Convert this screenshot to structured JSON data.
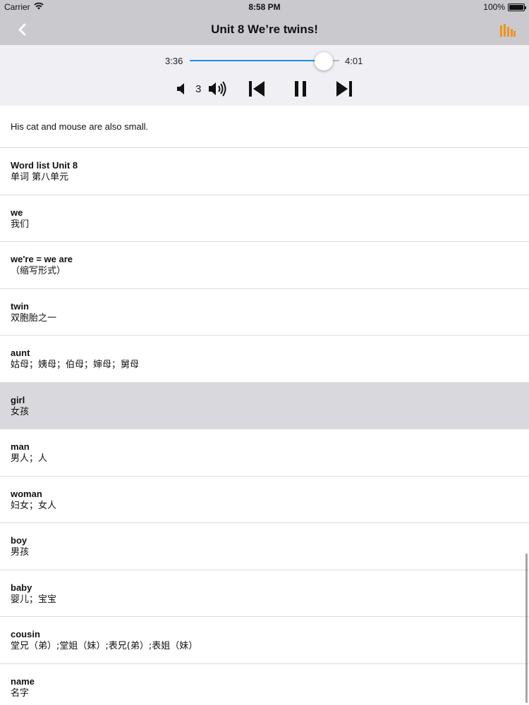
{
  "status_bar": {
    "carrier": "Carrier",
    "time": "8:58 PM",
    "battery": "100%",
    "battery_level": 1.0
  },
  "nav": {
    "title": "Unit 8 We’re twins!",
    "back_icon": "chevron-left-icon",
    "right_icon": "bar-chart-icon",
    "accent_color": "#f0931f"
  },
  "player": {
    "current_time": "3:36",
    "total_time": "4:01",
    "progress": 0.896,
    "volume": "3",
    "accent_color": "#1a8fe3"
  },
  "list": {
    "sentence": "His cat and mouse are also small.",
    "items": [
      {
        "word": "Word list Unit 8",
        "meaning": "单词 第八单元"
      },
      {
        "word": "we",
        "meaning": "我们"
      },
      {
        "word": "we're = we are",
        "meaning": "（缩写形式）"
      },
      {
        "word": "twin",
        "meaning": "双胞胎之一"
      },
      {
        "word": "aunt",
        "meaning": "姑母；姨母；伯母；婶母；舅母"
      },
      {
        "word": "girl",
        "meaning": "女孩"
      },
      {
        "word": "man",
        "meaning": "男人；人"
      },
      {
        "word": "woman",
        "meaning": "妇女；女人"
      },
      {
        "word": "boy",
        "meaning": "男孩"
      },
      {
        "word": "baby",
        "meaning": "婴儿；宝宝"
      },
      {
        "word": "cousin",
        "meaning": "堂兄（弟）;堂姐（妹）;表兄(弟）;表姐（妹）"
      },
      {
        "word": "name",
        "meaning": "名字"
      }
    ],
    "selected_index": 5
  }
}
